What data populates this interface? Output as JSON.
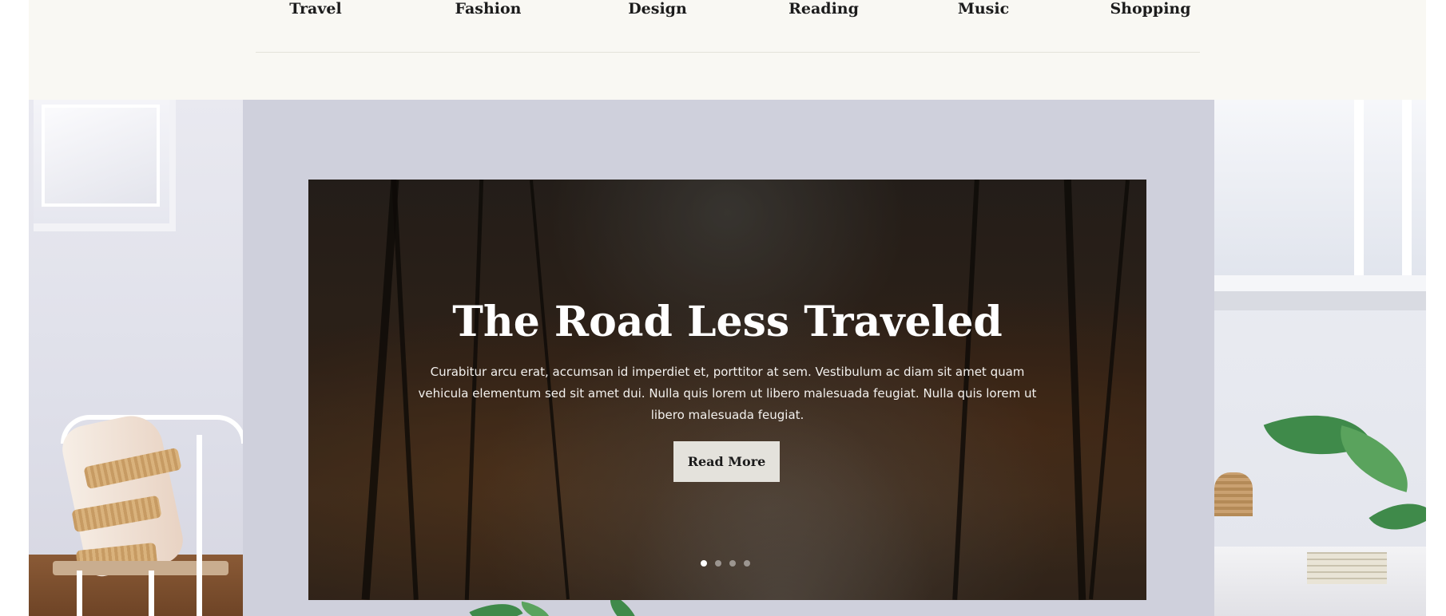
{
  "nav": {
    "items": [
      {
        "label": "Travel"
      },
      {
        "label": "Fashion"
      },
      {
        "label": "Design"
      },
      {
        "label": "Reading"
      },
      {
        "label": "Music"
      },
      {
        "label": "Shopping"
      }
    ]
  },
  "slider": {
    "title": "The Road Less Traveled",
    "text": "Curabitur arcu erat, accumsan id imperdiet et, porttitor at sem. Vestibulum ac diam sit amet quam vehicula elementum sed sit amet dui. Nulla quis lorem ut libero malesuada feugiat. Nulla quis lorem ut libero malesuada feugiat.",
    "button_label": "Read More",
    "slide_count": 4,
    "active_slide": 1
  },
  "colors": {
    "header_bg": "#f9f8f3",
    "scene_wall": "#cfd0dc",
    "button_bg": "#e4e2dc",
    "text_dark": "#1c1c1c"
  }
}
